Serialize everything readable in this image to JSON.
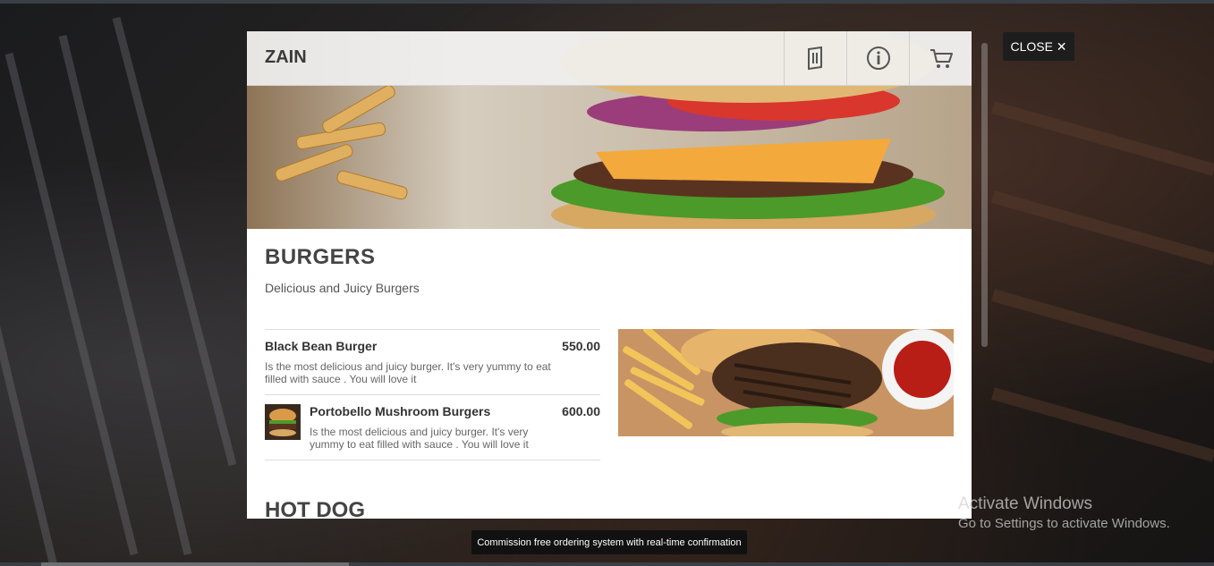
{
  "header": {
    "brand": "ZAIN",
    "icons": [
      "menu-book-icon",
      "info-icon",
      "cart-icon"
    ]
  },
  "close": {
    "label": "CLOSE ✕"
  },
  "section": {
    "title": "BURGERS",
    "subtitle": "Delicious and Juicy Burgers"
  },
  "items": [
    {
      "name": "Black Bean Burger",
      "price": "550.00",
      "description": "Is the most delicious and juicy burger. It's very yummy to eat filled with sauce . You will love it"
    },
    {
      "name": "Portobello Mushroom Burgers",
      "price": "600.00",
      "description": "Is the most delicious and juicy burger. It's very yummy to eat filled with sauce . You will love it"
    }
  ],
  "next_section": {
    "title": "HOT DOG"
  },
  "tooltip": {
    "text": "Commission free ordering system with real-time confirmation"
  },
  "watermark": {
    "title": "Activate Windows",
    "subtitle": "Go to Settings to activate Windows."
  },
  "colors": {
    "header_bg": "#f0f0f0",
    "text_dark": "#333333",
    "close_bg": "#1d1d1d"
  }
}
